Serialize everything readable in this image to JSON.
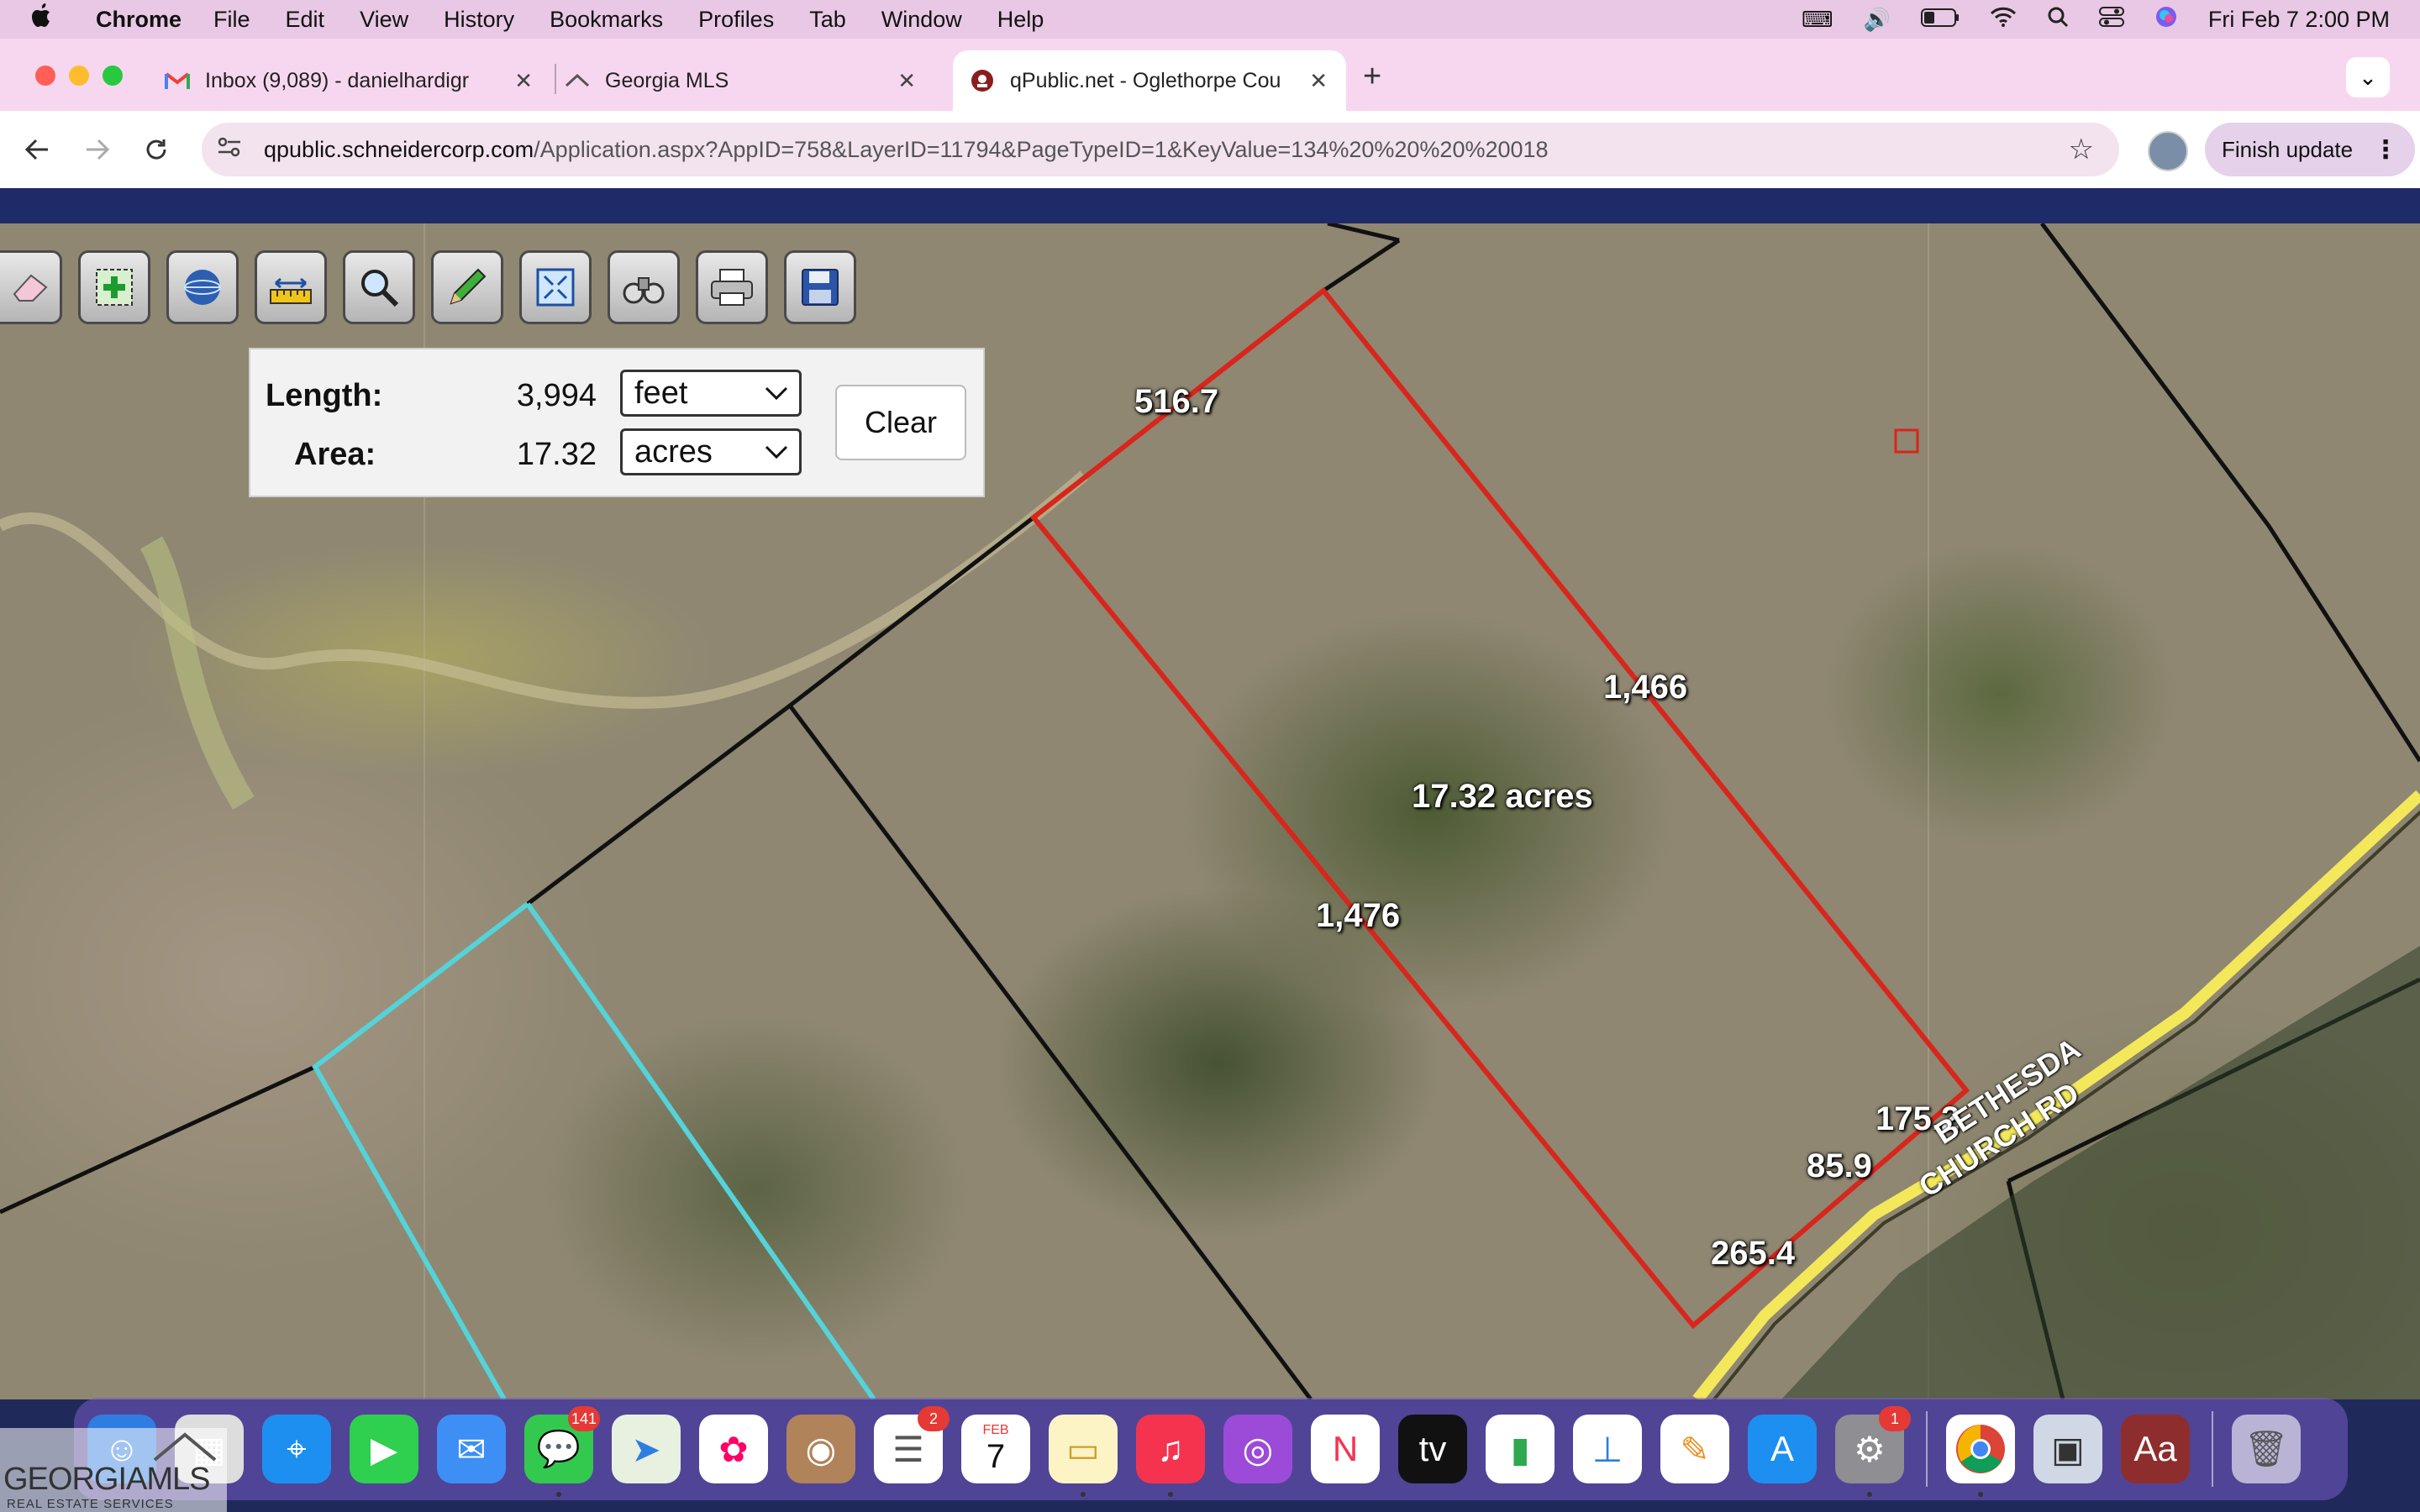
{
  "menubar": {
    "apple": "",
    "app": "Chrome",
    "items": [
      "File",
      "Edit",
      "View",
      "History",
      "Bookmarks",
      "Profiles",
      "Tab",
      "Window",
      "Help"
    ],
    "clock": "Fri Feb 7  2:00 PM"
  },
  "tabs": [
    {
      "title": "Inbox (9,089) - danielhardigr",
      "icon": "gmail-icon"
    },
    {
      "title": "Georgia MLS",
      "icon": "georgia-mls-icon"
    },
    {
      "title": "qPublic.net - Oglethorpe Cou",
      "icon": "qpublic-icon",
      "active": true
    }
  ],
  "toolbar": {
    "url_host": "qpublic.schneidercorp.com",
    "url_path": "/Application.aspx?AppID=758&LayerID=11794&PageTypeID=1&KeyValue=134%20%20%20%20018",
    "finish_update": "Finish update"
  },
  "measure": {
    "length_label": "Length:",
    "length_value": "3,994",
    "length_unit": "feet",
    "area_label": "Area:",
    "area_value": "17.32",
    "area_unit": "acres",
    "clear": "Clear"
  },
  "map": {
    "segments": [
      "516.7",
      "1,466",
      "1,476",
      "175.2",
      "85.9",
      "265.4"
    ],
    "area_label": "17.32 acres",
    "road_line1": "BETHESDA",
    "road_line2": "CHURCH RD",
    "parcel_color": "#d8261c",
    "neighbor_color": "#54d3d9"
  },
  "watermark": {
    "brand": "GEORGIAMLS",
    "tagline": "REAL ESTATE SERVICES"
  },
  "dock": {
    "messages_badge": "141",
    "reminders_badge": "2",
    "calendar_month": "FEB",
    "calendar_day": "7",
    "settings_badge": "1"
  }
}
